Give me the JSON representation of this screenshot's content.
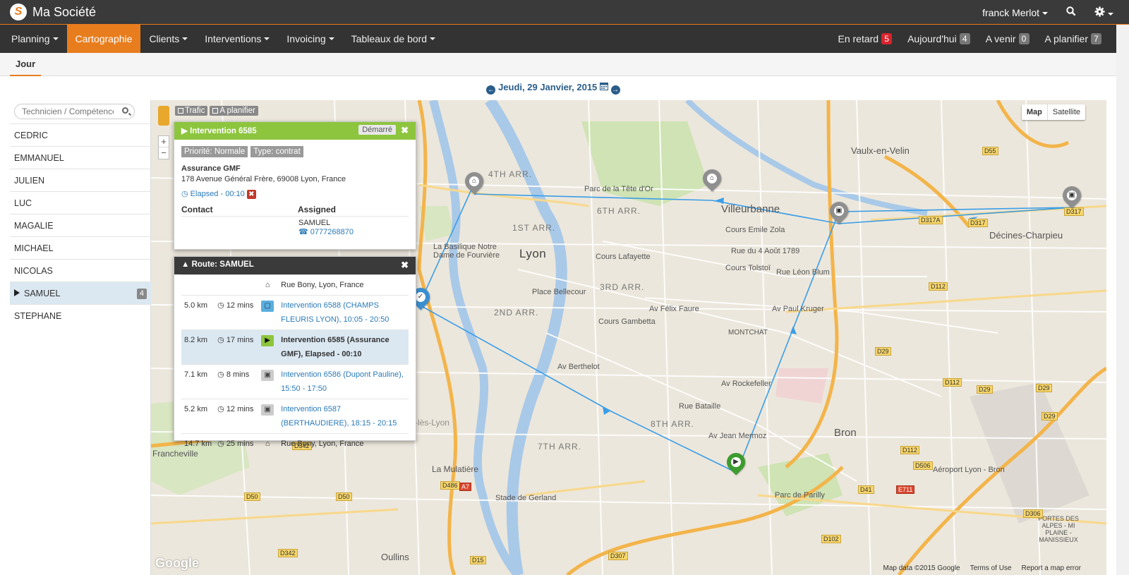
{
  "app": {
    "name": "Ma Société",
    "user": "franck Merlot"
  },
  "nav": {
    "items": [
      {
        "label": "Planning",
        "caret": true
      },
      {
        "label": "Cartographie",
        "caret": false,
        "active": true
      },
      {
        "label": "Clients",
        "caret": true
      },
      {
        "label": "Interventions",
        "caret": true
      },
      {
        "label": "Invoicing",
        "caret": true
      },
      {
        "label": "Tableaux de bord",
        "caret": true
      }
    ],
    "status": [
      {
        "label": "En retard",
        "count": "5",
        "color": "#d9232d"
      },
      {
        "label": "Aujourd'hui",
        "count": "4",
        "color": "#777777"
      },
      {
        "label": "A venir",
        "count": "0",
        "color": "#777777"
      },
      {
        "label": "A planifier",
        "count": "7",
        "color": "#777777"
      }
    ]
  },
  "subnav": {
    "tab": "Jour"
  },
  "date": {
    "label": "Jeudi, 29 Janvier, 2015"
  },
  "sidebar": {
    "search_placeholder": "Technicien / Compétence",
    "technicians": [
      {
        "name": "CEDRIC"
      },
      {
        "name": "EMMANUEL"
      },
      {
        "name": "JULIEN"
      },
      {
        "name": "LUC"
      },
      {
        "name": "MAGALIE"
      },
      {
        "name": "MICHAEL"
      },
      {
        "name": "NICOLAS"
      },
      {
        "name": "SAMUEL",
        "selected": true,
        "count": "4"
      },
      {
        "name": "STEPHANE"
      }
    ]
  },
  "map": {
    "toggle": {
      "map": "Map",
      "satellite": "Satellite"
    },
    "buttons": {
      "traffic": "Trafic",
      "to_plan": "A planifier"
    },
    "zoom": {
      "in": "+",
      "out": "−"
    },
    "labels": {
      "city_lyon": "Lyon",
      "city_villeurbanne": "Villeurbanne",
      "city_vaulx": "Vaulx-en-Velin",
      "city_decines": "Décines-Charpieu",
      "city_bron": "Bron",
      "oullins": "Oullins",
      "mulatiere": "La Mulatière",
      "francheville": "Francheville",
      "stefoy": "Sainte-Foy-lès-Lyon",
      "arr_1": "1ST ARR.",
      "arr_2": "2ND ARR.",
      "arr_3": "3RD ARR.",
      "arr_4": "4TH ARR.",
      "arr_6": "6TH ARR.",
      "arr_7": "7TH ARR.",
      "arr_8": "8TH ARR.",
      "parc_tete": "Parc de la Tête d'Or",
      "parc_parilly": "Parc de Parilly",
      "bellecour": "Place Bellecour",
      "basilique": "La Basilique Notre Dame de Fourvière",
      "stade": "Stade de Gerland",
      "aeroport": "Aéroport Lyon - Bron",
      "montchat": "MONTCHAT",
      "emile_zola": "Cours Emile Zola",
      "aout": "Rue du 4 Août 1789",
      "tolstoi": "Cours Tolstoï",
      "leon_blum": "Rue Léon Blum",
      "paul_kruger": "Av Paul Kruger",
      "felix_faure": "Av Félix Faure",
      "lafayette": "Cours Lafayette",
      "gambetta": "Cours Gambetta",
      "berthelot": "Av Berthelot",
      "rockefeller": "Av Rockefeller",
      "bataille": "Rue Bataille",
      "jean_mermoz": "Av Jean Mermoz",
      "portes_alpes": "PORTES DES ALPES - MI PLAINE - MANISSIEUX"
    },
    "roads": [
      "D317",
      "D317A",
      "D317",
      "D112",
      "D29",
      "D29",
      "D112",
      "D29",
      "D112",
      "D506",
      "D41",
      "D306",
      "D342",
      "D486",
      "D50",
      "D50",
      "D342",
      "D307",
      "D15",
      "D102",
      "D55",
      "D29"
    ],
    "roads_red": [
      "A7",
      "E711"
    ],
    "footer": {
      "data": "Map data ©2015 Google",
      "terms": "Terms of Use",
      "report": "Report a map error"
    },
    "google": "Google"
  },
  "intervention_popup": {
    "title": "Intervention 6585",
    "status": "Démarré",
    "tags": [
      "Priorité: Normale",
      "Type: contrat"
    ],
    "client": "Assurance GMF",
    "address": "178 Avenue Général Frère, 69008 Lyon, France",
    "elapsed": "Elapsed - 00:10",
    "contact_header": "Contact",
    "assigned_header": "Assigned",
    "assigned_name": "SAMUEL",
    "assigned_phone": "0777268870"
  },
  "route_popup": {
    "title": "Route: SAMUEL",
    "start": "Rue Bony, Lyon, France",
    "stops": [
      {
        "distance": "5.0 km",
        "duration": "12 mins",
        "kind": "blue",
        "text": "Intervention 6588 (CHAMPS FLEURIS LYON), 10:05 - 20:50",
        "link": true
      },
      {
        "distance": "8.2 km",
        "duration": "17 mins",
        "kind": "green",
        "text": "Intervention 6585 (Assurance GMF), Elapsed - 00:10",
        "link": false,
        "selected": true
      },
      {
        "distance": "7.1 km",
        "duration": "8 mins",
        "kind": "grey",
        "text": "Intervention 6586 (Dupont Pauline), 15:50 - 17:50",
        "link": true
      },
      {
        "distance": "5.2 km",
        "duration": "12 mins",
        "kind": "grey",
        "text": "Intervention 6587 (BERTHAUDIERE), 18:15 - 20:15",
        "link": true
      }
    ],
    "end": {
      "distance": "14.7 km",
      "duration": "25 mins",
      "text": "Rue Bony, Lyon, France"
    }
  },
  "colors": {
    "accent": "#e87d1e",
    "route": "#3a9ee8",
    "header": "#3a3a3a"
  }
}
